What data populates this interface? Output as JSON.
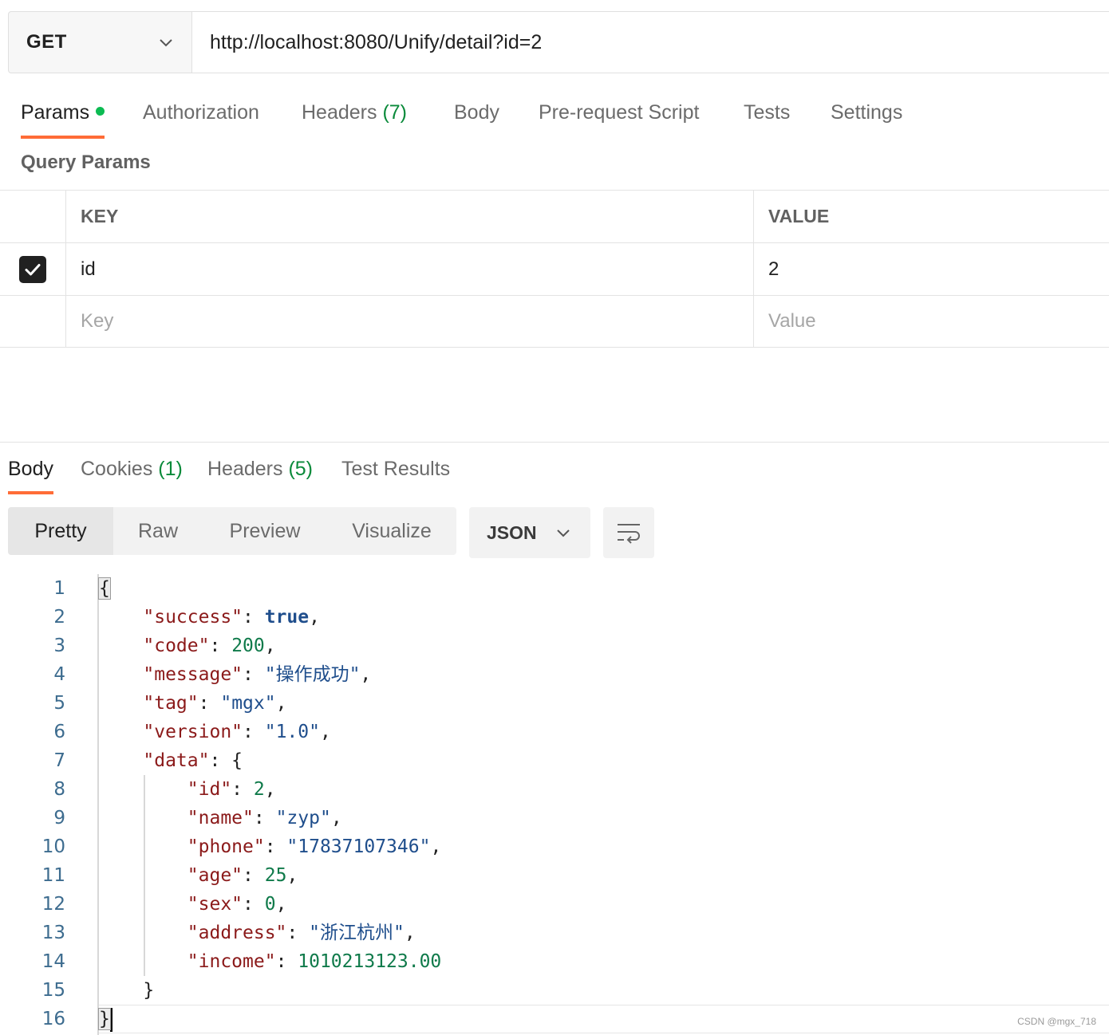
{
  "request": {
    "method": "GET",
    "url": "http://localhost:8080/Unify/detail?id=2"
  },
  "request_tabs": [
    {
      "label": "Params",
      "count": "",
      "active": true,
      "has_dot": true
    },
    {
      "label": "Authorization",
      "count": ""
    },
    {
      "label": "Headers",
      "count": "(7)"
    },
    {
      "label": "Body",
      "count": ""
    },
    {
      "label": "Pre-request Script",
      "count": ""
    },
    {
      "label": "Tests",
      "count": ""
    },
    {
      "label": "Settings",
      "count": ""
    }
  ],
  "query_params": {
    "title": "Query Params",
    "headers": {
      "key": "KEY",
      "value": "VALUE"
    },
    "rows": [
      {
        "checked": true,
        "key": "id",
        "value": "2"
      }
    ],
    "new_row": {
      "key_placeholder": "Key",
      "value_placeholder": "Value"
    }
  },
  "response_tabs": [
    {
      "label": "Body",
      "count": "",
      "active": true
    },
    {
      "label": "Cookies",
      "count": "(1)"
    },
    {
      "label": "Headers",
      "count": "(5)"
    },
    {
      "label": "Test Results",
      "count": ""
    }
  ],
  "view_modes": [
    "Pretty",
    "Raw",
    "Preview",
    "Visualize"
  ],
  "active_view_mode": "Pretty",
  "format": "JSON",
  "icons": {
    "method_dropdown": "chevron-down-icon",
    "format_dropdown": "chevron-down-icon",
    "wrap": "wrap-lines-icon",
    "checkbox": "check-icon"
  },
  "colors": {
    "accent": "#ff6c37",
    "status_dot": "#0cbb52",
    "count": "#0a8a3a",
    "json_key": "#8b1a1a",
    "json_string": "#1f4e8c",
    "json_number": "#0f7a4a"
  },
  "body_lines": [
    {
      "no": "1",
      "tokens": [
        {
          "t": "{",
          "c": "p"
        }
      ]
    },
    {
      "no": "2",
      "tokens": [
        {
          "t": "    ",
          "c": "p"
        },
        {
          "t": "\"success\"",
          "c": "k"
        },
        {
          "t": ": ",
          "c": "p"
        },
        {
          "t": "true",
          "c": "b"
        },
        {
          "t": ",",
          "c": "p"
        }
      ]
    },
    {
      "no": "3",
      "tokens": [
        {
          "t": "    ",
          "c": "p"
        },
        {
          "t": "\"code\"",
          "c": "k"
        },
        {
          "t": ": ",
          "c": "p"
        },
        {
          "t": "200",
          "c": "n"
        },
        {
          "t": ",",
          "c": "p"
        }
      ]
    },
    {
      "no": "4",
      "tokens": [
        {
          "t": "    ",
          "c": "p"
        },
        {
          "t": "\"message\"",
          "c": "k"
        },
        {
          "t": ": ",
          "c": "p"
        },
        {
          "t": "\"操作成功\"",
          "c": "s"
        },
        {
          "t": ",",
          "c": "p"
        }
      ]
    },
    {
      "no": "5",
      "tokens": [
        {
          "t": "    ",
          "c": "p"
        },
        {
          "t": "\"tag\"",
          "c": "k"
        },
        {
          "t": ": ",
          "c": "p"
        },
        {
          "t": "\"mgx\"",
          "c": "s"
        },
        {
          "t": ",",
          "c": "p"
        }
      ]
    },
    {
      "no": "6",
      "tokens": [
        {
          "t": "    ",
          "c": "p"
        },
        {
          "t": "\"version\"",
          "c": "k"
        },
        {
          "t": ": ",
          "c": "p"
        },
        {
          "t": "\"1.0\"",
          "c": "s"
        },
        {
          "t": ",",
          "c": "p"
        }
      ]
    },
    {
      "no": "7",
      "tokens": [
        {
          "t": "    ",
          "c": "p"
        },
        {
          "t": "\"data\"",
          "c": "k"
        },
        {
          "t": ": {",
          "c": "p"
        }
      ]
    },
    {
      "no": "8",
      "tokens": [
        {
          "t": "        ",
          "c": "p"
        },
        {
          "t": "\"id\"",
          "c": "k"
        },
        {
          "t": ": ",
          "c": "p"
        },
        {
          "t": "2",
          "c": "n"
        },
        {
          "t": ",",
          "c": "p"
        }
      ]
    },
    {
      "no": "9",
      "tokens": [
        {
          "t": "        ",
          "c": "p"
        },
        {
          "t": "\"name\"",
          "c": "k"
        },
        {
          "t": ": ",
          "c": "p"
        },
        {
          "t": "\"zyp\"",
          "c": "s"
        },
        {
          "t": ",",
          "c": "p"
        }
      ]
    },
    {
      "no": "10",
      "tokens": [
        {
          "t": "        ",
          "c": "p"
        },
        {
          "t": "\"phone\"",
          "c": "k"
        },
        {
          "t": ": ",
          "c": "p"
        },
        {
          "t": "\"17837107346\"",
          "c": "s"
        },
        {
          "t": ",",
          "c": "p"
        }
      ]
    },
    {
      "no": "11",
      "tokens": [
        {
          "t": "        ",
          "c": "p"
        },
        {
          "t": "\"age\"",
          "c": "k"
        },
        {
          "t": ": ",
          "c": "p"
        },
        {
          "t": "25",
          "c": "n"
        },
        {
          "t": ",",
          "c": "p"
        }
      ]
    },
    {
      "no": "12",
      "tokens": [
        {
          "t": "        ",
          "c": "p"
        },
        {
          "t": "\"sex\"",
          "c": "k"
        },
        {
          "t": ": ",
          "c": "p"
        },
        {
          "t": "0",
          "c": "n"
        },
        {
          "t": ",",
          "c": "p"
        }
      ]
    },
    {
      "no": "13",
      "tokens": [
        {
          "t": "        ",
          "c": "p"
        },
        {
          "t": "\"address\"",
          "c": "k"
        },
        {
          "t": ": ",
          "c": "p"
        },
        {
          "t": "\"浙江杭州\"",
          "c": "s"
        },
        {
          "t": ",",
          "c": "p"
        }
      ]
    },
    {
      "no": "14",
      "tokens": [
        {
          "t": "        ",
          "c": "p"
        },
        {
          "t": "\"income\"",
          "c": "k"
        },
        {
          "t": ": ",
          "c": "p"
        },
        {
          "t": "1010213123.00",
          "c": "n"
        }
      ]
    },
    {
      "no": "15",
      "tokens": [
        {
          "t": "    }",
          "c": "p"
        }
      ]
    },
    {
      "no": "16",
      "tokens": [
        {
          "t": "}",
          "c": "p"
        }
      ]
    }
  ],
  "watermark": "CSDN @mgx_718"
}
